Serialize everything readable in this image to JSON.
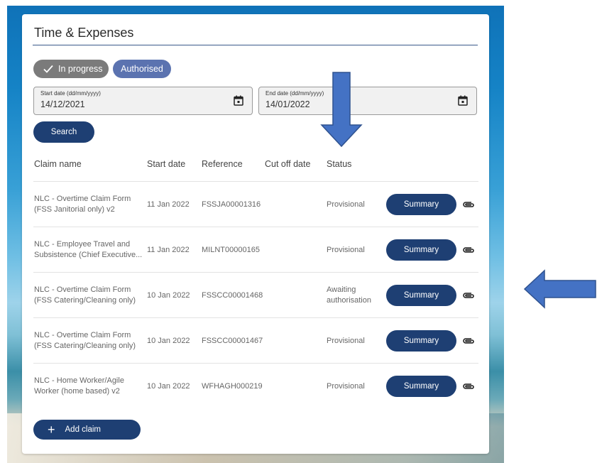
{
  "header": {
    "title": "Time & Expenses"
  },
  "filters": {
    "chips": [
      {
        "label": "In progress",
        "selected": true
      },
      {
        "label": "Authorised",
        "selected": false
      }
    ],
    "start_date": {
      "label": "Start date (dd/mm/yyyy)",
      "value": "14/12/2021"
    },
    "end_date": {
      "label": "End date (dd/mm/yyyy)",
      "value": "14/01/2022"
    },
    "search_label": "Search"
  },
  "table": {
    "columns": [
      "Claim name",
      "Start date",
      "Reference",
      "Cut off date",
      "Status"
    ],
    "rows": [
      {
        "name_line1": "NLC - Overtime Claim Form",
        "name_line2": "(FSS Janitorial only) v2",
        "start_date": "11 Jan 2022",
        "reference": "FSSJA00001316",
        "cut_off": "",
        "status_line1": "Provisional",
        "status_line2": "",
        "action": "Summary"
      },
      {
        "name_line1": "NLC - Employee Travel and",
        "name_line2": "Subsistence (Chief Executive...",
        "start_date": "11 Jan 2022",
        "reference": "MILNT00000165",
        "cut_off": "",
        "status_line1": "Provisional",
        "status_line2": "",
        "action": "Summary"
      },
      {
        "name_line1": "NLC - Overtime Claim Form",
        "name_line2": "(FSS Catering/Cleaning only)",
        "start_date": "10 Jan 2022",
        "reference": "FSSCC00001468",
        "cut_off": "",
        "status_line1": "Awaiting",
        "status_line2": "authorisation",
        "action": "Summary"
      },
      {
        "name_line1": "NLC - Overtime Claim Form",
        "name_line2": "(FSS Catering/Cleaning only)",
        "start_date": "10 Jan 2022",
        "reference": "FSSCC00001467",
        "cut_off": "",
        "status_line1": "Provisional",
        "status_line2": "",
        "action": "Summary"
      },
      {
        "name_line1": "NLC - Home Worker/Agile",
        "name_line2": "Worker (home based) v2",
        "start_date": "10 Jan 2022",
        "reference": "WFHAGH000219",
        "cut_off": "",
        "status_line1": "Provisional",
        "status_line2": "",
        "action": "Summary"
      }
    ]
  },
  "add_claim_label": "Add claim",
  "icons": {
    "chip_check": "check-icon",
    "date_picker": "calendar-icon",
    "attachment": "paperclip-icon",
    "add": "plus-icon"
  },
  "colors": {
    "primary_button": "#1e3f73",
    "chip_selected": "#7b7b7b",
    "chip_unselected": "#5b73b0",
    "annotation_arrow": "#4472c4"
  }
}
